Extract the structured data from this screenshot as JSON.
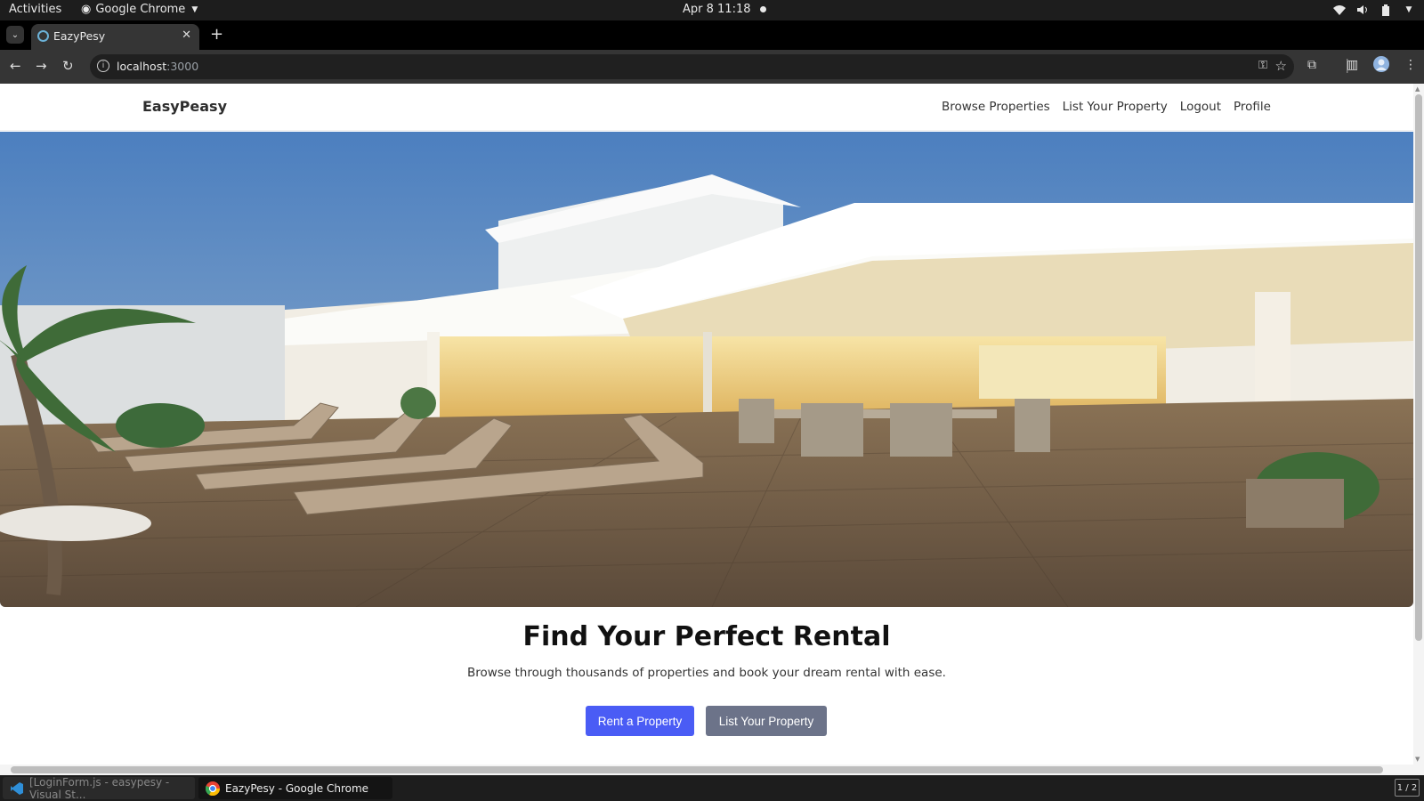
{
  "system": {
    "activities": "Activities",
    "app_name": "Google Chrome",
    "clock": "Apr 8  11:18"
  },
  "browser": {
    "tab_title": "EazyPesy",
    "url_host": "localhost",
    "url_port": ":3000"
  },
  "site": {
    "brand": "EasyPeasy",
    "nav": [
      "Browse Properties",
      "List Your Property",
      "Logout",
      "Profile"
    ],
    "headline": "Find Your Perfect Rental",
    "subheadline": "Browse through thousands of properties and book your dream rental with ease.",
    "primary_button": "Rent a Property",
    "secondary_button": "List Your Property",
    "accent_color": "#4a5cf5",
    "secondary_color": "#6c7389"
  },
  "taskbar": {
    "items": [
      "[LoginForm.js - easypesy - Visual St...",
      "EazyPesy - Google Chrome"
    ],
    "workspace": "1 / 2"
  }
}
